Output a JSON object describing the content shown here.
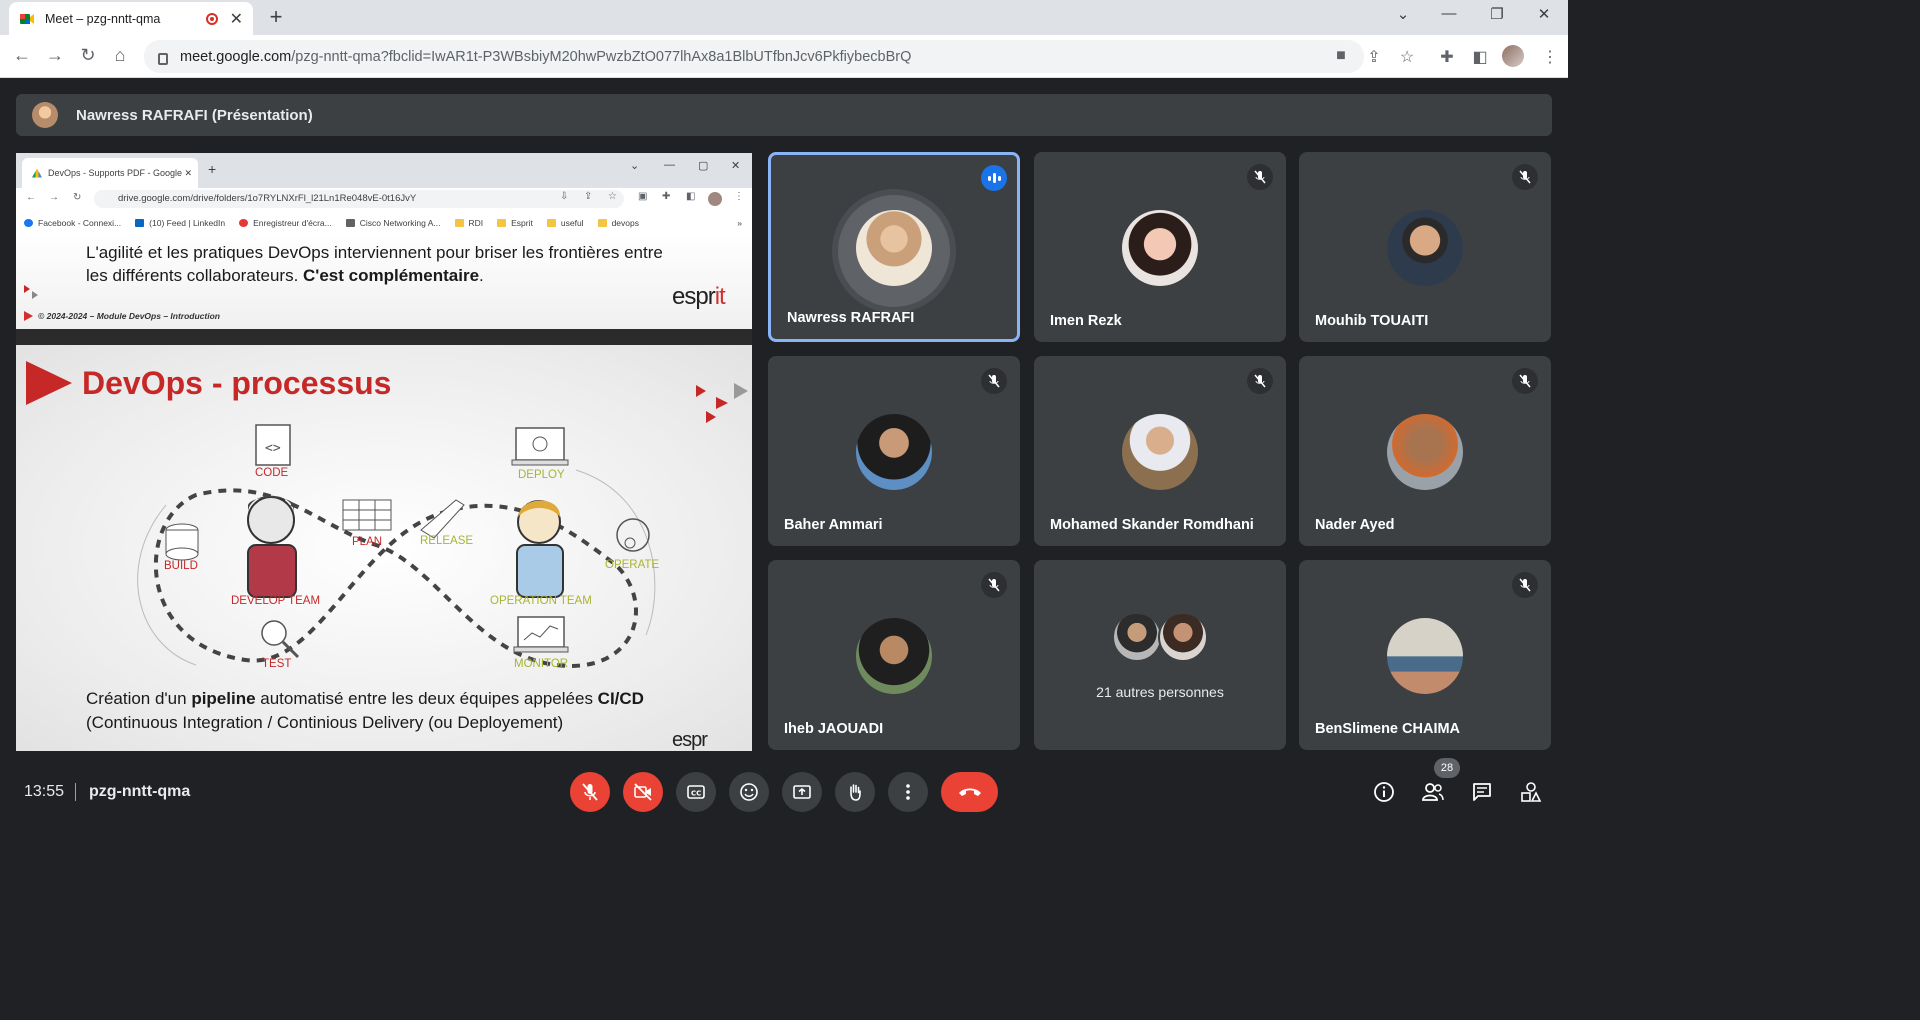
{
  "browser": {
    "tab_title": "Meet – pzg-nntt-qma",
    "tab_close": "✕",
    "new_tab": "+",
    "url_host": "meet.google.com",
    "url_path": "/pzg-nntt-qma?fbclid=IwAR1t-P3WBsbiyM20hwPwzbZtO077lhAx8a1BlbUTfbnJcv6PkfiybecbBrQ"
  },
  "presenter_bar": {
    "label": "Nawress RAFRAFI (Présentation)"
  },
  "shared_browser": {
    "tab_title": "DevOps - Supports PDF - Google",
    "url": "drive.google.com/drive/folders/1o7RYLNXrFl_l21Ln1Re048vE-0t16JvY",
    "bookmarks": [
      {
        "label": "Facebook - Connexi...",
        "color": "#1877f2"
      },
      {
        "label": "(10) Feed | LinkedIn",
        "color": "#0a66c2"
      },
      {
        "label": "Enregistreur d'écra...",
        "color": "#e53935"
      },
      {
        "label": "Cisco Networking A...",
        "color": "#5f6368"
      },
      {
        "label": "RDI",
        "color": "#f4c542"
      },
      {
        "label": "Esprit",
        "color": "#f4c542"
      },
      {
        "label": "useful",
        "color": "#f4c542"
      },
      {
        "label": "devops",
        "color": "#f4c542"
      }
    ],
    "more": "»"
  },
  "slide_top": {
    "line1": "L'agilité et les pratiques DevOps interviennent pour briser les  frontières entre",
    "line2_pre": "les différents collaborateurs. ",
    "line2_bold": "C'est  complémentaire",
    "line2_post": ".",
    "copyright": "© 2024-2024 – Module DevOps – Introduction",
    "logo_a": "espr",
    "logo_b": "it"
  },
  "slide_main": {
    "title": "DevOps - processus",
    "labels": {
      "code": "CODE",
      "build": "BUILD",
      "develop": "DEVELOP TEAM",
      "plan": "PLAN",
      "test": "TEST",
      "release": "RELEASE",
      "deploy": "DEPLOY",
      "operate": "OPERATE",
      "operation": "OPERATION TEAM",
      "monitor": "MONITOR"
    },
    "bottom1_a": "Création d'un ",
    "bottom1_b": "pipeline",
    "bottom1_c": " automatisé entre les deux équipes appelées ",
    "bottom1_d": "CI/CD",
    "bottom2": "(Continuous Integration / Continious Delivery (ou Deployement)",
    "logo": "espr"
  },
  "participants": [
    {
      "name": "Nawress RAFRAFI",
      "muted": false,
      "speaking": true
    },
    {
      "name": "Imen Rezk",
      "muted": true
    },
    {
      "name": "Mouhib TOUAITI",
      "muted": true
    },
    {
      "name": "Baher Ammari",
      "muted": true
    },
    {
      "name": "Mohamed Skander Romdhani",
      "muted": true
    },
    {
      "name": "Nader Ayed",
      "muted": true
    },
    {
      "name": "Iheb JAOUADI",
      "muted": true
    },
    {
      "name": "21 autres personnes",
      "muted": false
    },
    {
      "name": "BenSlimene CHAIMA",
      "muted": true
    }
  ],
  "controls": {
    "time": "13:55",
    "meeting_code": "pzg-nntt-qma",
    "participant_count": "28"
  }
}
